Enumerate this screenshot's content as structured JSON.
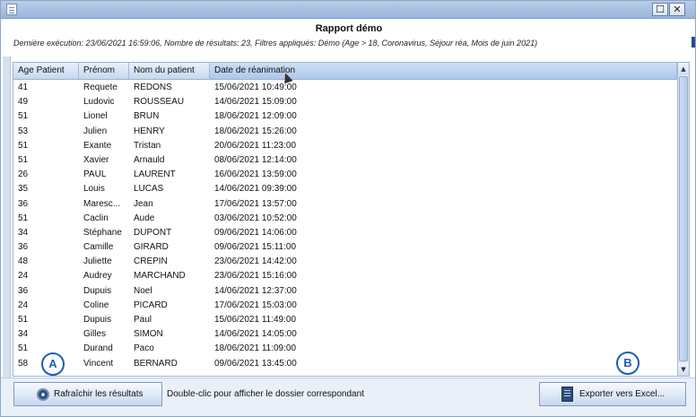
{
  "window": {
    "maximize_glyph": "☐",
    "close_glyph": "✕"
  },
  "report": {
    "title": "Rapport démo",
    "subtitle": "Dernière exécution: 23/06/2021 16:59:06, Nombre de résultats: 23, Filtres appliqués: Démo (Age > 18, Coronavirus, Séjour réa, Mois de juin 2021)"
  },
  "table": {
    "columns": [
      "Age Patient",
      "Prénom",
      "Nom du patient",
      "Date de réanimation"
    ],
    "sorted_column": "Date de réanimation",
    "rows": [
      [
        "41",
        "Requete",
        "REDONS",
        "15/06/2021 10:49:00"
      ],
      [
        "49",
        "Ludovic",
        "ROUSSEAU",
        "14/06/2021 15:09:00"
      ],
      [
        "51",
        "Lionel",
        "BRUN",
        "18/06/2021 12:09:00"
      ],
      [
        "53",
        "Julien",
        "HENRY",
        "18/06/2021 15:26:00"
      ],
      [
        "51",
        "Exante",
        "Tristan",
        "20/06/2021 11:23:00"
      ],
      [
        "51",
        "Xavier",
        "Arnauld",
        "08/06/2021 12:14:00"
      ],
      [
        "26",
        "PAUL",
        "LAURENT",
        "16/06/2021 13:59:00"
      ],
      [
        "35",
        "Louis",
        "LUCAS",
        "14/06/2021 09:39:00"
      ],
      [
        "36",
        "Maresc...",
        "Jean",
        "17/06/2021 13:57:00"
      ],
      [
        "51",
        "Caclin",
        "Aude",
        "03/06/2021 10:52:00"
      ],
      [
        "34",
        "Stéphane",
        "DUPONT",
        "09/06/2021 14:06:00"
      ],
      [
        "36",
        "Camille",
        "GIRARD",
        "09/06/2021 15:11:00"
      ],
      [
        "48",
        "Juliette",
        "CREPIN",
        "23/06/2021 14:42:00"
      ],
      [
        "24",
        "Audrey",
        "MARCHAND",
        "23/06/2021 15:16:00"
      ],
      [
        "36",
        "Dupuis",
        "Noel",
        "14/06/2021 12:37:00"
      ],
      [
        "24",
        "Coline",
        "PICARD",
        "17/06/2021 15:03:00"
      ],
      [
        "51",
        "Dupuis",
        "Paul",
        "15/06/2021 11:49:00"
      ],
      [
        "34",
        "Gilles",
        "SIMON",
        "14/06/2021 14:05:00"
      ],
      [
        "51",
        "Durand",
        "Paco",
        "18/06/2021 11:09:00"
      ],
      [
        "58",
        "Vincent",
        "BERNARD",
        "09/06/2021 13:45:00"
      ]
    ]
  },
  "footer": {
    "refresh_label": "Rafraîchir les résultats",
    "hint": "Double-clic pour afficher le dossier correspondant",
    "export_label": "Exporter vers Excel..."
  },
  "markers": {
    "a": "A",
    "b": "B"
  },
  "icons": {
    "refresh": "refresh-icon",
    "excel": "excel-icon",
    "maximize": "maximize-icon",
    "close": "close-icon"
  },
  "colors": {
    "marker": "#1e5db6",
    "header": "#c6d8ef"
  }
}
